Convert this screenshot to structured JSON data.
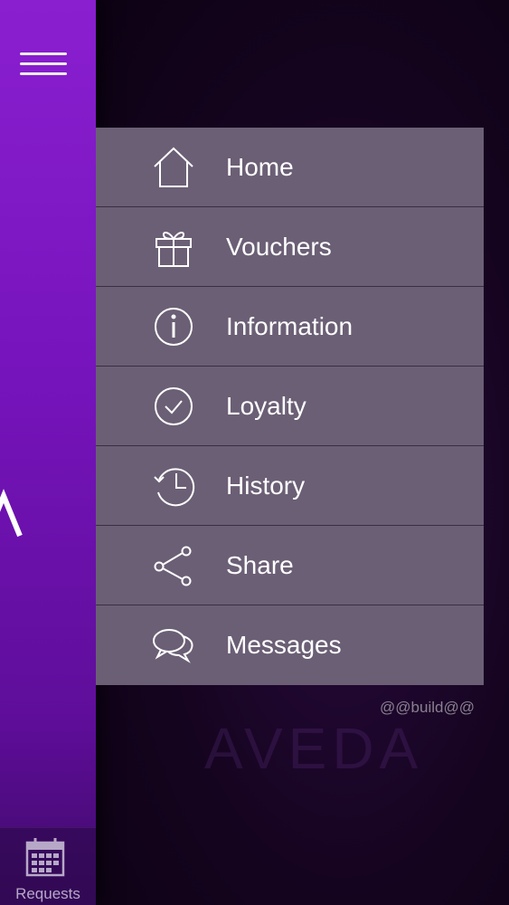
{
  "menu": {
    "items": [
      {
        "label": "Home",
        "icon": "home-icon"
      },
      {
        "label": "Vouchers",
        "icon": "gift-icon"
      },
      {
        "label": "Information",
        "icon": "info-icon"
      },
      {
        "label": "Loyalty",
        "icon": "check-circle-icon"
      },
      {
        "label": "History",
        "icon": "history-icon"
      },
      {
        "label": "Share",
        "icon": "share-icon"
      },
      {
        "label": "Messages",
        "icon": "chat-bubbles-icon"
      }
    ]
  },
  "footer": {
    "build_label": "@@build@@"
  },
  "tabbar": {
    "requests_label": "Requests",
    "requests_icon": "calendar-icon"
  },
  "header": {
    "menu_icon": "hamburger-menu-icon"
  },
  "background": {
    "logo_text": "AVEDA"
  },
  "colors": {
    "strip": "#7714bd",
    "menu_bg": "#6b5f75",
    "divider": "#3a2d44",
    "text": "#ffffff"
  }
}
